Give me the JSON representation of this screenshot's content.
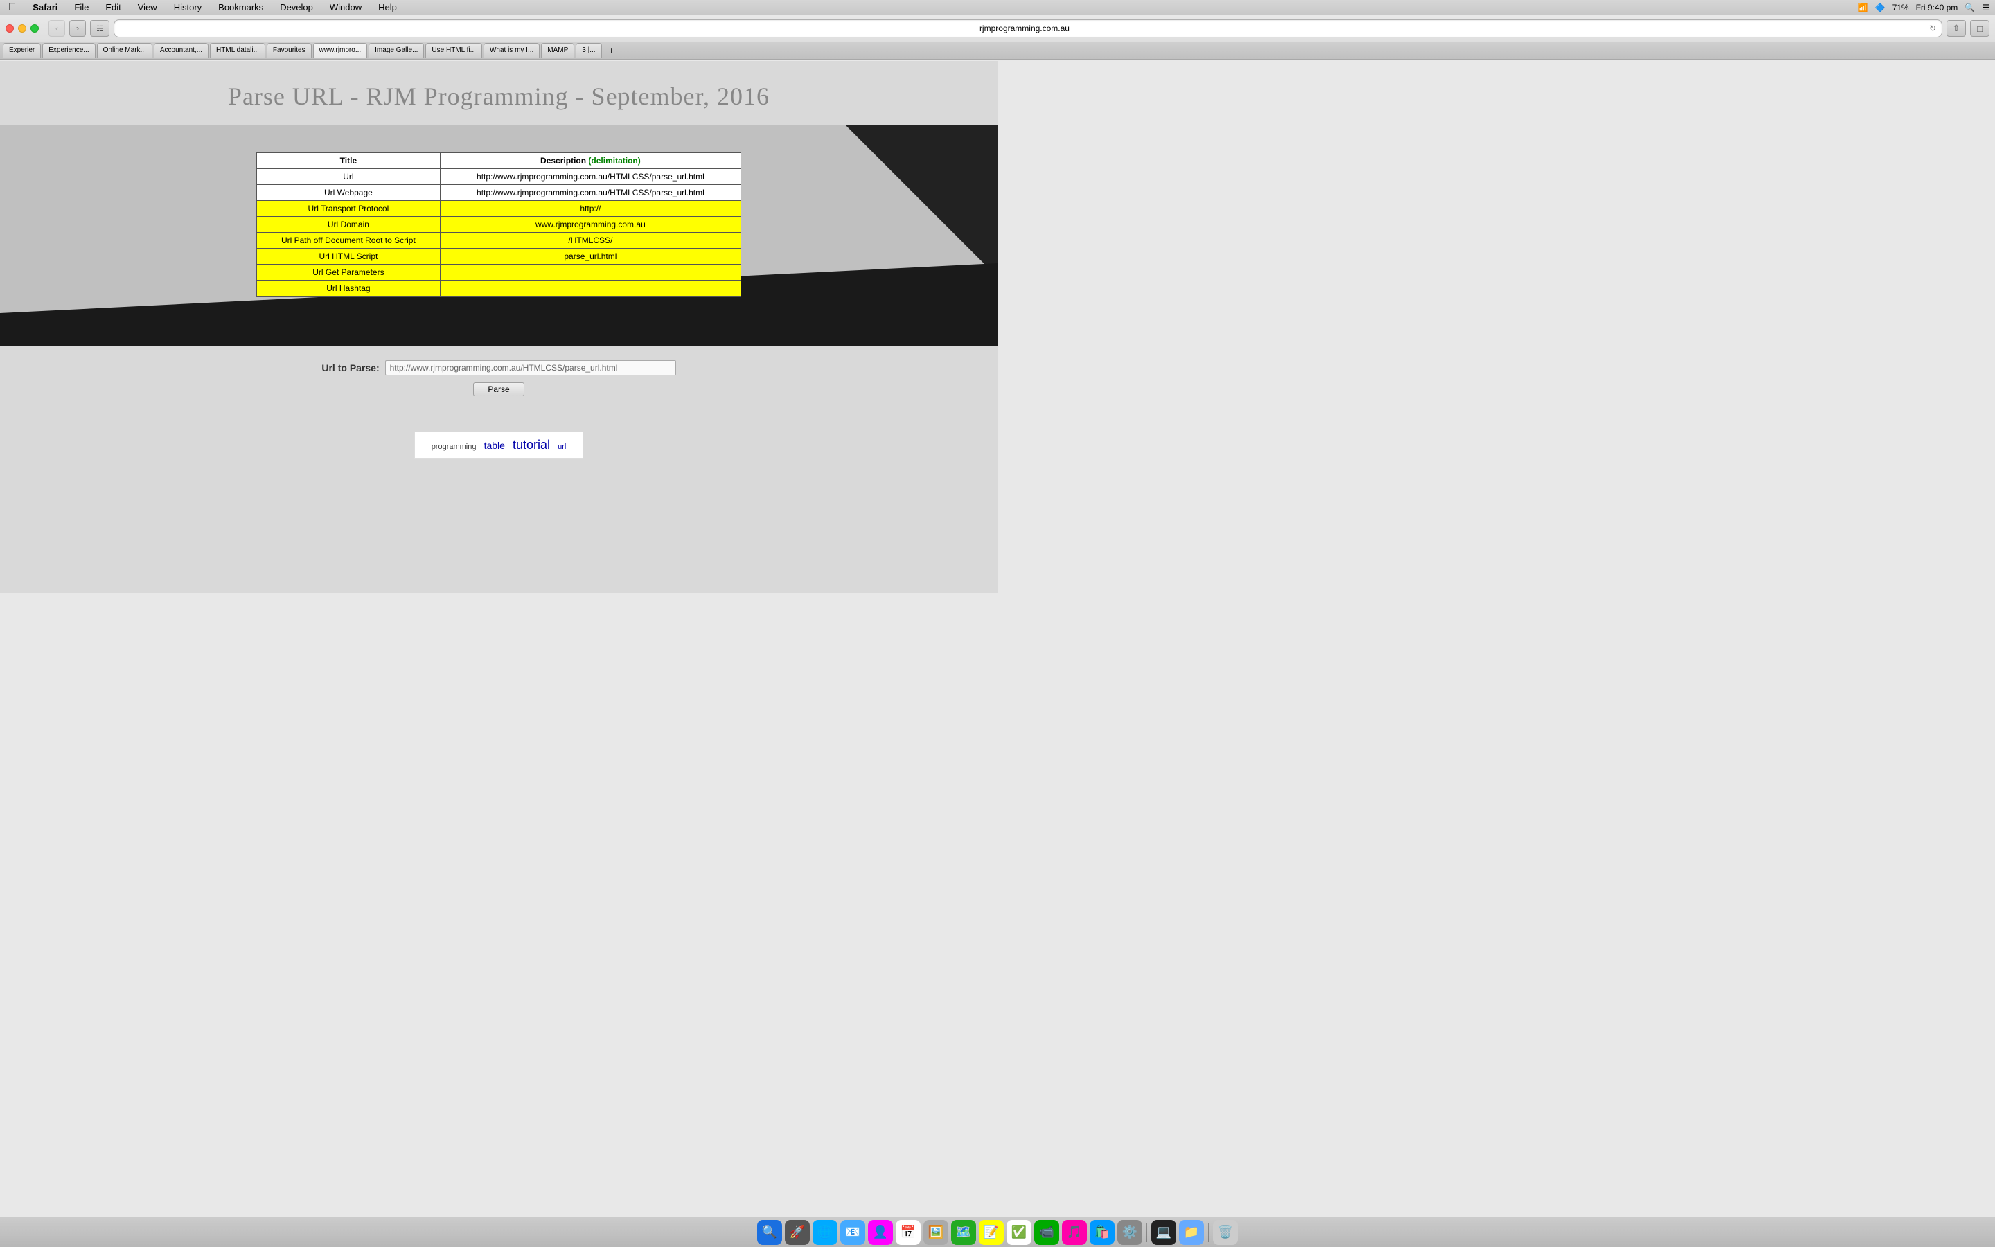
{
  "menubar": {
    "apple": "⌘",
    "items": [
      "Safari",
      "File",
      "Edit",
      "View",
      "History",
      "Bookmarks",
      "Develop",
      "Window",
      "Help"
    ],
    "right": {
      "battery": "71%",
      "time": "Fri 9:40 pm",
      "wifi": "WiFi"
    }
  },
  "browser": {
    "address": "rjmprogramming.com.au",
    "tabs": [
      {
        "label": "Experier",
        "active": false
      },
      {
        "label": "Experience...",
        "active": false
      },
      {
        "label": "Online Mark...",
        "active": false
      },
      {
        "label": "Accountant,...",
        "active": false
      },
      {
        "label": "HTML datali...",
        "active": false
      },
      {
        "label": "Favourites",
        "active": false
      },
      {
        "label": "www.rjmpro...",
        "active": true
      },
      {
        "label": "Image Galle...",
        "active": false
      },
      {
        "label": "Use HTML fi...",
        "active": false
      },
      {
        "label": "What is my I...",
        "active": false
      },
      {
        "label": "MAMP",
        "active": false
      },
      {
        "label": "3 |...",
        "active": false
      }
    ]
  },
  "page": {
    "title": "Parse URL - RJM Programming - September, 2016",
    "table": {
      "headers": [
        "Title",
        "Description (delimitation)"
      ],
      "header_description_highlight": "(delimitation)",
      "rows_white": [
        {
          "title": "Url",
          "description": "http://www.rjmprogramming.com.au/HTMLCSS/parse_url.html"
        },
        {
          "title": "Url Webpage",
          "description": "http://www.rjmprogramming.com.au/HTMLCSS/parse_url.html"
        }
      ],
      "rows_yellow": [
        {
          "title": "Url Transport Protocol",
          "description": "http://"
        },
        {
          "title": "Url Domain",
          "description": "www.rjmprogramming.com.au"
        },
        {
          "title": "Url Path off Document Root to Script",
          "description": "/HTMLCSS/"
        },
        {
          "title": "Url HTML Script",
          "description": "parse_url.html"
        },
        {
          "title": "Url Get Parameters",
          "description": ""
        },
        {
          "title": "Url Hashtag",
          "description": ""
        }
      ]
    },
    "url_parse": {
      "label": "Url to Parse:",
      "input_value": "http://www.rjmprogramming.com.au/HTMLCSS/parse_url.html",
      "input_placeholder": "http://www.rjmprogramming.com.au/HTMLCSS/parse_url.html",
      "button_label": "Parse"
    },
    "tags": [
      "programming",
      "table",
      "tutorial",
      "url"
    ]
  },
  "dock": {
    "icons": [
      "🔍",
      "📁",
      "📧",
      "🌐",
      "📝",
      "🎵",
      "📷",
      "⚙️",
      "🗑️"
    ]
  }
}
